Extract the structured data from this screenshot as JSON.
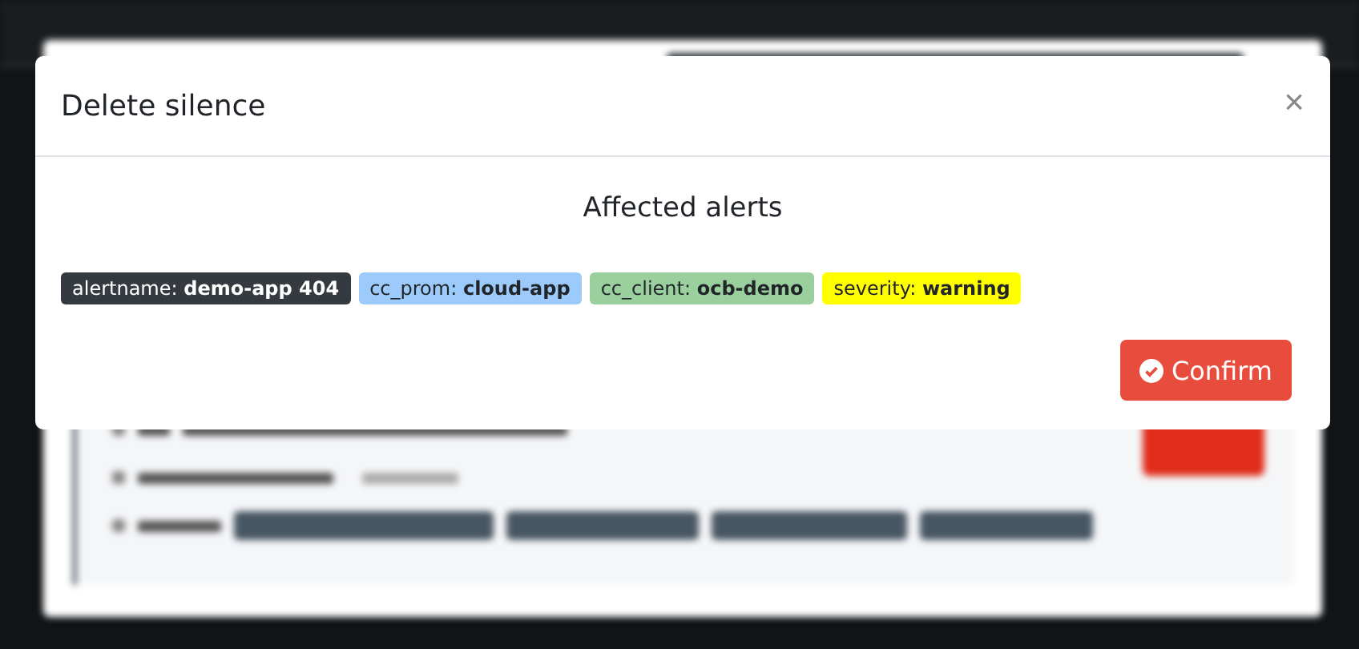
{
  "modal": {
    "title": "Delete silence",
    "close": "×",
    "heading": "Affected alerts",
    "labels": [
      {
        "name": "alertname:",
        "value": "demo-app 404",
        "color": "#343a40"
      },
      {
        "name": "cc_prom:",
        "value": "cloud-app",
        "color": "#9ccbfb"
      },
      {
        "name": "cc_client:",
        "value": "ocb-demo",
        "color": "#9ad09d"
      },
      {
        "name": "severity:",
        "value": "warning",
        "color": "#ffff00"
      }
    ],
    "confirm_button": "Confirm"
  }
}
